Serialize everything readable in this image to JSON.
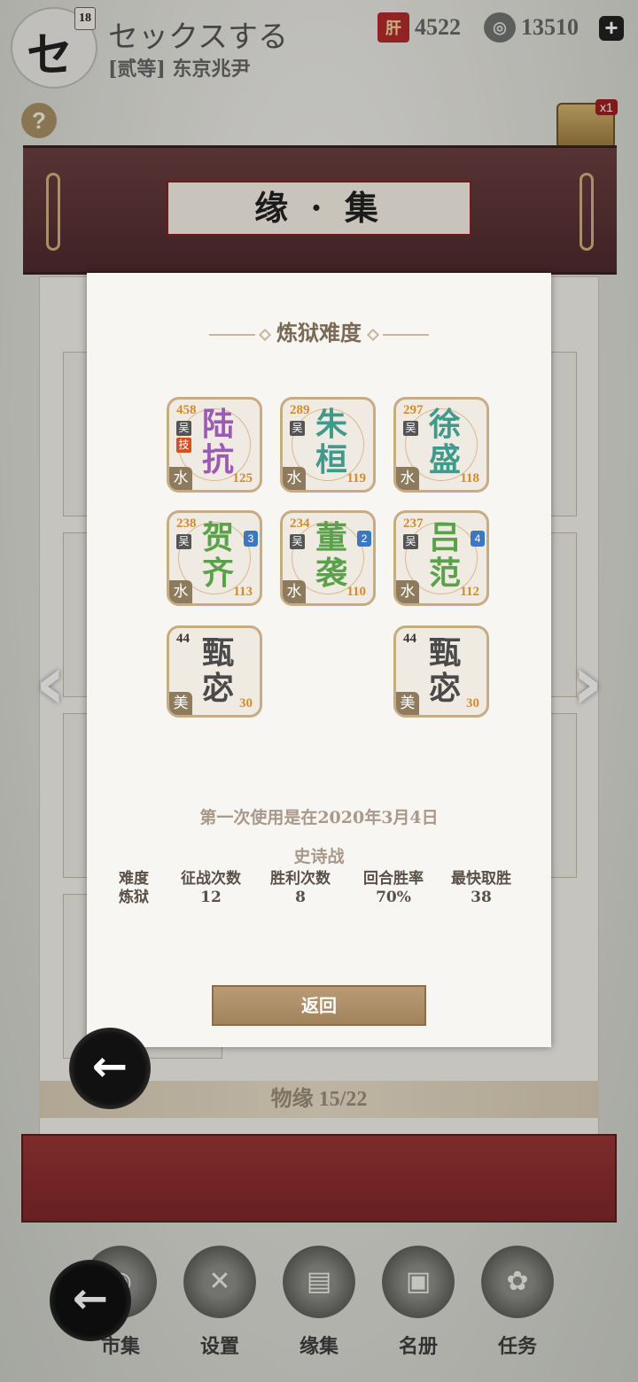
{
  "player": {
    "avatar_char": "セ",
    "level": "18",
    "name": "セックスする",
    "title": "[贰等] 东京兆尹"
  },
  "resources": {
    "currency_a_icon": "肝",
    "currency_a": "4522",
    "currency_b_icon": "◎",
    "currency_b": "13510",
    "plus": "+"
  },
  "help_icon": "?",
  "scroll_count": "x1",
  "banner_title": "缘 · 集",
  "wuyuan": "物缘  15/22",
  "side_arrows": {
    "left": "‹",
    "right": "›"
  },
  "back_ink": "←",
  "nav": [
    {
      "label": "市集",
      "icon": "◉"
    },
    {
      "label": "设置",
      "icon": "✕"
    },
    {
      "label": "缘集",
      "icon": "▤"
    },
    {
      "label": "名册",
      "icon": "▣"
    },
    {
      "label": "任务",
      "icon": "✿"
    }
  ],
  "modal": {
    "title": "炼狱难度",
    "heroes": [
      {
        "name1": "陆",
        "name2": "抗",
        "level": "458",
        "faction": "吴",
        "skill": "技",
        "element": "水",
        "power": "125",
        "color": "#9c5bb2"
      },
      {
        "name1": "朱",
        "name2": "桓",
        "level": "289",
        "faction": "吴",
        "element": "水",
        "power": "119",
        "color": "#3f9a8c"
      },
      {
        "name1": "徐",
        "name2": "盛",
        "level": "297",
        "faction": "吴",
        "element": "水",
        "power": "118",
        "color": "#3f9a8c"
      },
      {
        "name1": "贺",
        "name2": "齐",
        "level": "238",
        "faction": "吴",
        "rank": "3",
        "element": "水",
        "power": "113",
        "color": "#5aa24a"
      },
      {
        "name1": "董",
        "name2": "袭",
        "level": "234",
        "faction": "吴",
        "rank": "2",
        "element": "水",
        "power": "110",
        "color": "#5aa24a"
      },
      {
        "name1": "吕",
        "name2": "范",
        "level": "237",
        "faction": "吴",
        "rank": "4",
        "element": "水",
        "power": "112",
        "color": "#5aa24a"
      },
      {
        "name1": "甄",
        "name2": "宓",
        "level": "44",
        "element": "美",
        "power": "30",
        "color": "#4a4a4a"
      },
      {
        "name1": "甄",
        "name2": "宓",
        "level": "44",
        "element": "美",
        "power": "30",
        "color": "#4a4a4a"
      }
    ],
    "first_use": "第一次使用是在2020年3月4日",
    "battle_type": "史诗战",
    "stats": [
      {
        "header": "难度",
        "value": "炼狱"
      },
      {
        "header": "征战次数",
        "value": "12"
      },
      {
        "header": "胜利次数",
        "value": "8"
      },
      {
        "header": "回合胜率",
        "value": "70%"
      },
      {
        "header": "最快取胜",
        "value": "38"
      }
    ],
    "back_button": "返回"
  }
}
